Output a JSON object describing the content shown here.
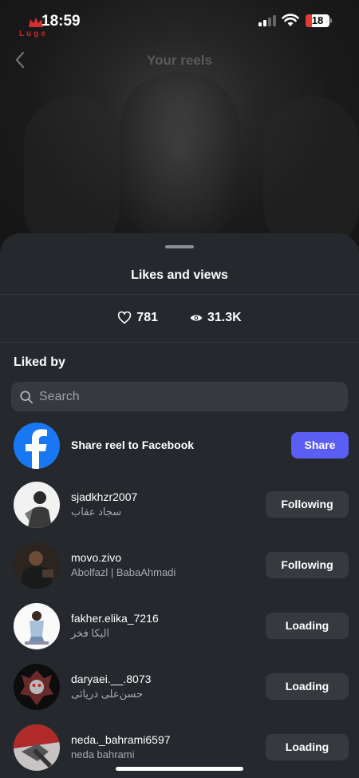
{
  "status_bar": {
    "time": "18:59",
    "battery": "18",
    "logo_text": "Luge"
  },
  "reel_header": {
    "title": "Your reels"
  },
  "sheet": {
    "title": "Likes and views",
    "likes": "781",
    "views": "31.3K",
    "liked_by_label": "Liked by",
    "search_placeholder": "Search"
  },
  "share_row": {
    "label": "Share reel to Facebook",
    "button": "Share"
  },
  "users": [
    {
      "username": "sjadkhzr2007",
      "name": "سجاد عقاب",
      "action": "Following"
    },
    {
      "username": "movo.zivo",
      "name": "Abolfazl | BabaAhmadi",
      "action": "Following"
    },
    {
      "username": "fakher.elika_7216",
      "name": "الیکا فخر",
      "action": "Loading"
    },
    {
      "username": "daryaei.__.8073",
      "name": "حسن‌علی دریائی",
      "action": "Loading"
    },
    {
      "username": "neda._bahrami6597",
      "name": "neda bahrami",
      "action": "Loading"
    }
  ],
  "colors": {
    "sheet_bg": "#25282c",
    "button_bg": "#363a3f",
    "accent": "#5b5ef5",
    "facebook": "#1877f2"
  }
}
